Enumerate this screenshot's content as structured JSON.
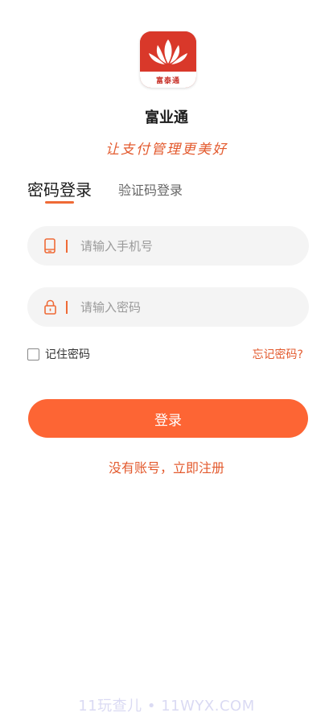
{
  "brand": {
    "logo_text": "富泰通",
    "name": "富业通",
    "slogan": "让支付管理更美好",
    "accent_color": "#fd6534"
  },
  "tabs": [
    {
      "label": "密码登录",
      "active": true
    },
    {
      "label": "验证码登录",
      "active": false
    }
  ],
  "form": {
    "phone": {
      "icon": "phone-icon",
      "placeholder": "请输入手机号",
      "value": ""
    },
    "password": {
      "icon": "lock-icon",
      "placeholder": "请输入密码",
      "value": ""
    },
    "remember_label": "记住密码",
    "remember_checked": false,
    "forgot_label": "忘记密码?",
    "submit_label": "登录",
    "register_label": "没有账号，立即注册"
  },
  "watermark": "11玩查儿 • 11WYX.COM"
}
